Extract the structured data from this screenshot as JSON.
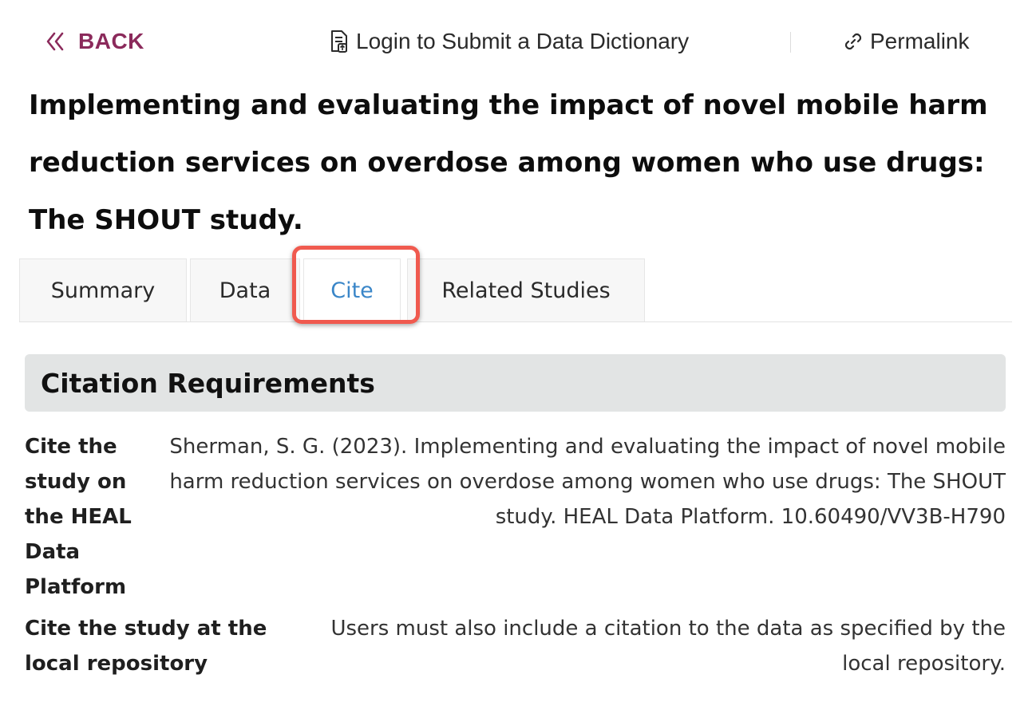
{
  "nav": {
    "back_label": "BACK",
    "submit_dictionary_label": "Login to Submit a Data Dictionary",
    "permalink_label": "Permalink"
  },
  "study": {
    "title": "Implementing and evaluating the impact of novel mobile harm reduction services on overdose among women who use drugs: The SHOUT study."
  },
  "tabs": [
    {
      "label": "Summary",
      "active": false
    },
    {
      "label": "Data",
      "active": false
    },
    {
      "label": "Cite",
      "active": true
    },
    {
      "label": "Related Studies",
      "active": false
    }
  ],
  "citation": {
    "heading": "Citation Requirements",
    "rows": [
      {
        "label": "Cite the study on the HEAL Data Platform",
        "value": "Sherman, S. G. (2023). Implementing and evaluating the impact of novel mobile harm reduction services on overdose among women who use drugs: The SHOUT study. HEAL Data Platform. 10.60490/VV3B-H790"
      },
      {
        "label": "Cite the study at the local repository",
        "value": "Users must also include a citation to the data as specified by the local repository."
      }
    ]
  },
  "colors": {
    "back": "#8b2a5b",
    "active_tab": "#3a86c8",
    "highlight": "#f05a4f",
    "section_bg": "#e2e4e4"
  },
  "icons": {
    "back": "double-chevron-left-icon",
    "submit_dictionary": "document-upload-icon",
    "permalink": "link-icon"
  }
}
